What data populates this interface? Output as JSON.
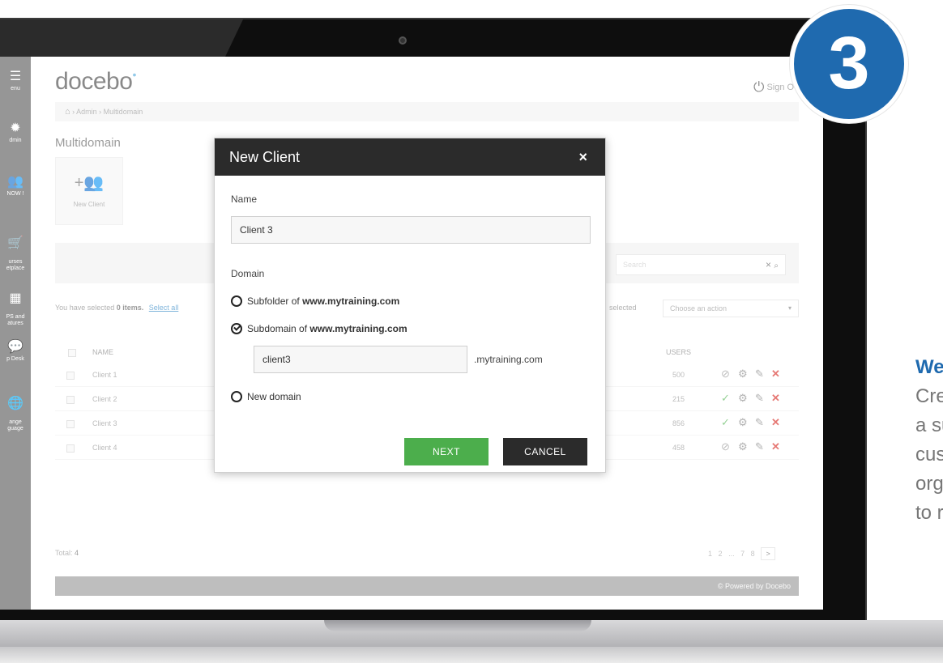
{
  "badge": {
    "number": "3",
    "color": "#1f6aaf"
  },
  "side_text": {
    "heading": "We",
    "lines": [
      "Cre",
      "a su",
      "cust",
      "orga",
      "to r"
    ]
  },
  "sidebar": {
    "items": [
      {
        "icon": "☰",
        "label": "enu"
      },
      {
        "icon": "✹",
        "label": "dmin"
      },
      {
        "icon": "👥",
        "label": "NOW !"
      },
      {
        "icon": "🛒",
        "label": "urses\netplace"
      },
      {
        "icon": "▦",
        "label": "PS and\natures"
      },
      {
        "icon": "💬",
        "label": "p Desk"
      },
      {
        "icon": "🌐",
        "label": "ange\nguage"
      }
    ]
  },
  "app": {
    "logo": "docebo",
    "logo_mark": "•",
    "signout": "Sign O",
    "breadcrumb": "› Admin › Multidomain",
    "page_title": "Multidomain",
    "new_client_tile": "New Client",
    "search_placeholder": "Search",
    "search_clear": "×",
    "search_go": "🔍",
    "selected_prefix": "You have selected",
    "selected_count": "0 items.",
    "select_all": "Select all",
    "selected_right": "selected",
    "action_placeholder": "Choose an action",
    "col_name": "NAME",
    "col_users": "USERS",
    "rows": [
      {
        "name": "Client 1",
        "users": "500",
        "active": false
      },
      {
        "name": "Client 2",
        "users": "215",
        "active": true
      },
      {
        "name": "Client 3",
        "users": "856",
        "active": true
      },
      {
        "name": "Client 4",
        "users": "458",
        "active": false
      }
    ],
    "total_label": "Total:",
    "total_value": "4",
    "pages": [
      "1",
      "2",
      "...",
      "7",
      "8"
    ],
    "next_page": ">",
    "footer": "© Powered by Docebo"
  },
  "modal": {
    "title": "New Client",
    "close": "×",
    "name_label": "Name",
    "name_value": "Client 3",
    "domain_label": "Domain",
    "opt_subfolder_prefix": "Subfolder of",
    "opt_subfolder_domain": "www.mytraining.com",
    "opt_subdomain_prefix": "Subdomain of",
    "opt_subdomain_domain": "www.mytraining.com",
    "subdomain_value": "client3",
    "subdomain_suffix": ".mytraining.com",
    "opt_new_domain": "New domain",
    "next_button": "NEXT",
    "cancel_button": "CANCEL",
    "selected_option": "subdomain"
  }
}
